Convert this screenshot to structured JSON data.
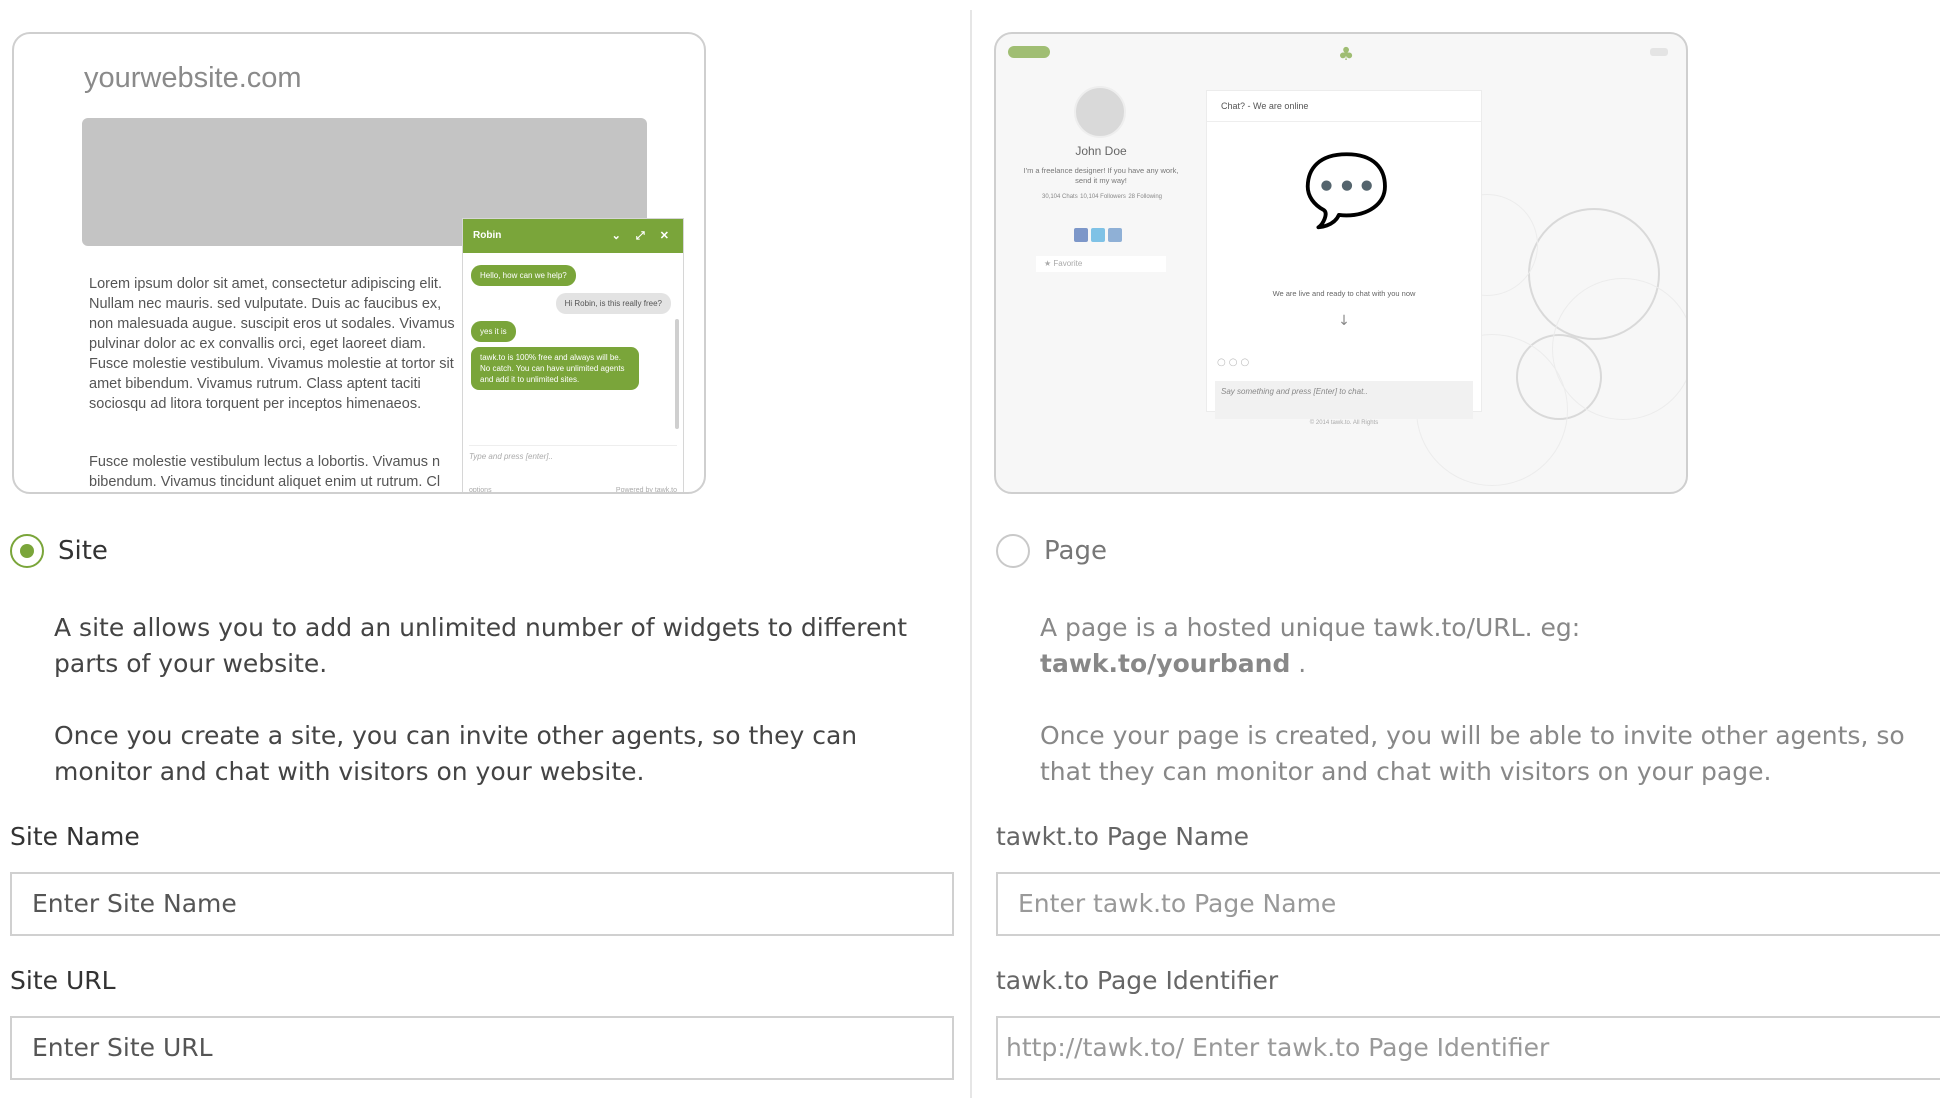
{
  "site": {
    "preview": {
      "domain": "yourwebsite.com",
      "lorem_p1": "Lorem ipsum dolor sit amet, consectetur adipiscing elit. Nullam nec mauris. sed vulputate. Duis ac faucibus ex, non malesuada augue. suscipit eros ut sodales. Vivamus pulvinar dolor ac ex convallis orci, eget laoreet diam. Fusce molestie vestibulum. Vivamus molestie at tortor sit amet bibendum. Vivamus rutrum. Class aptent taciti sociosqu ad litora torquent per inceptos himenaeos.",
      "lorem_p2": "Fusce molestie vestibulum lectus a lobortis. Vivamus n bibendum. Vivamus tincidunt aliquet enim ut rutrum. Cl",
      "widget": {
        "agent": "Robin",
        "controls": "⌄ ⤢ ✕",
        "msg1": "Hello, how can we help?",
        "msg2": "Hi Robin, is this really free?",
        "msg3": "yes it is",
        "msg4": "tawk.to is 100% free and always will be. No catch. You can have unlimited agents and add it to unlimited sites.",
        "input_placeholder": "Type and press [enter]..",
        "options": "options",
        "powered": "Powered by tawk.to"
      }
    },
    "radio_label": "Site",
    "desc1": "A site allows you to add an unlimited number of widgets to different parts of your website.",
    "desc2": "Once you create a site, you can invite other agents, so they can monitor and chat with visitors on your website.",
    "name_label": "Site Name",
    "name_placeholder": "Enter Site Name",
    "url_label": "Site URL",
    "url_placeholder": "Enter Site URL"
  },
  "page": {
    "preview": {
      "name": "John Doe",
      "bio": "I'm a freelance designer! If you have any work, send it my way!",
      "stats": [
        "30,104 Chats",
        "10,104 Followers",
        "28 Following"
      ],
      "favorite": "★  Favorite",
      "chat_title": "Chat? - We are online",
      "chat_msg": "We are live and ready to chat with you now",
      "chat_input": "Say something and press [Enter] to chat..",
      "copyright": "© 2014 tawk.to. All Rights"
    },
    "radio_label": "Page",
    "desc1_text": "A page is a hosted unique tawk.to/URL. eg:",
    "desc1_example": "tawk.to/yourband",
    "desc1_tail": " .",
    "desc2": "Once your page is created, you will be able to invite other agents, so that they can monitor and chat with visitors on your page.",
    "name_label": "tawkt.to Page Name",
    "name_placeholder": "Enter tawk.to Page Name",
    "id_label": "tawk.to Page Identifier",
    "id_prefix": "http://tawk.to/",
    "id_placeholder": "Enter tawk.to Page Identifier"
  },
  "colors": {
    "accent": "#7aa53a",
    "border": "#d0d0d0",
    "muted": "#888888"
  }
}
